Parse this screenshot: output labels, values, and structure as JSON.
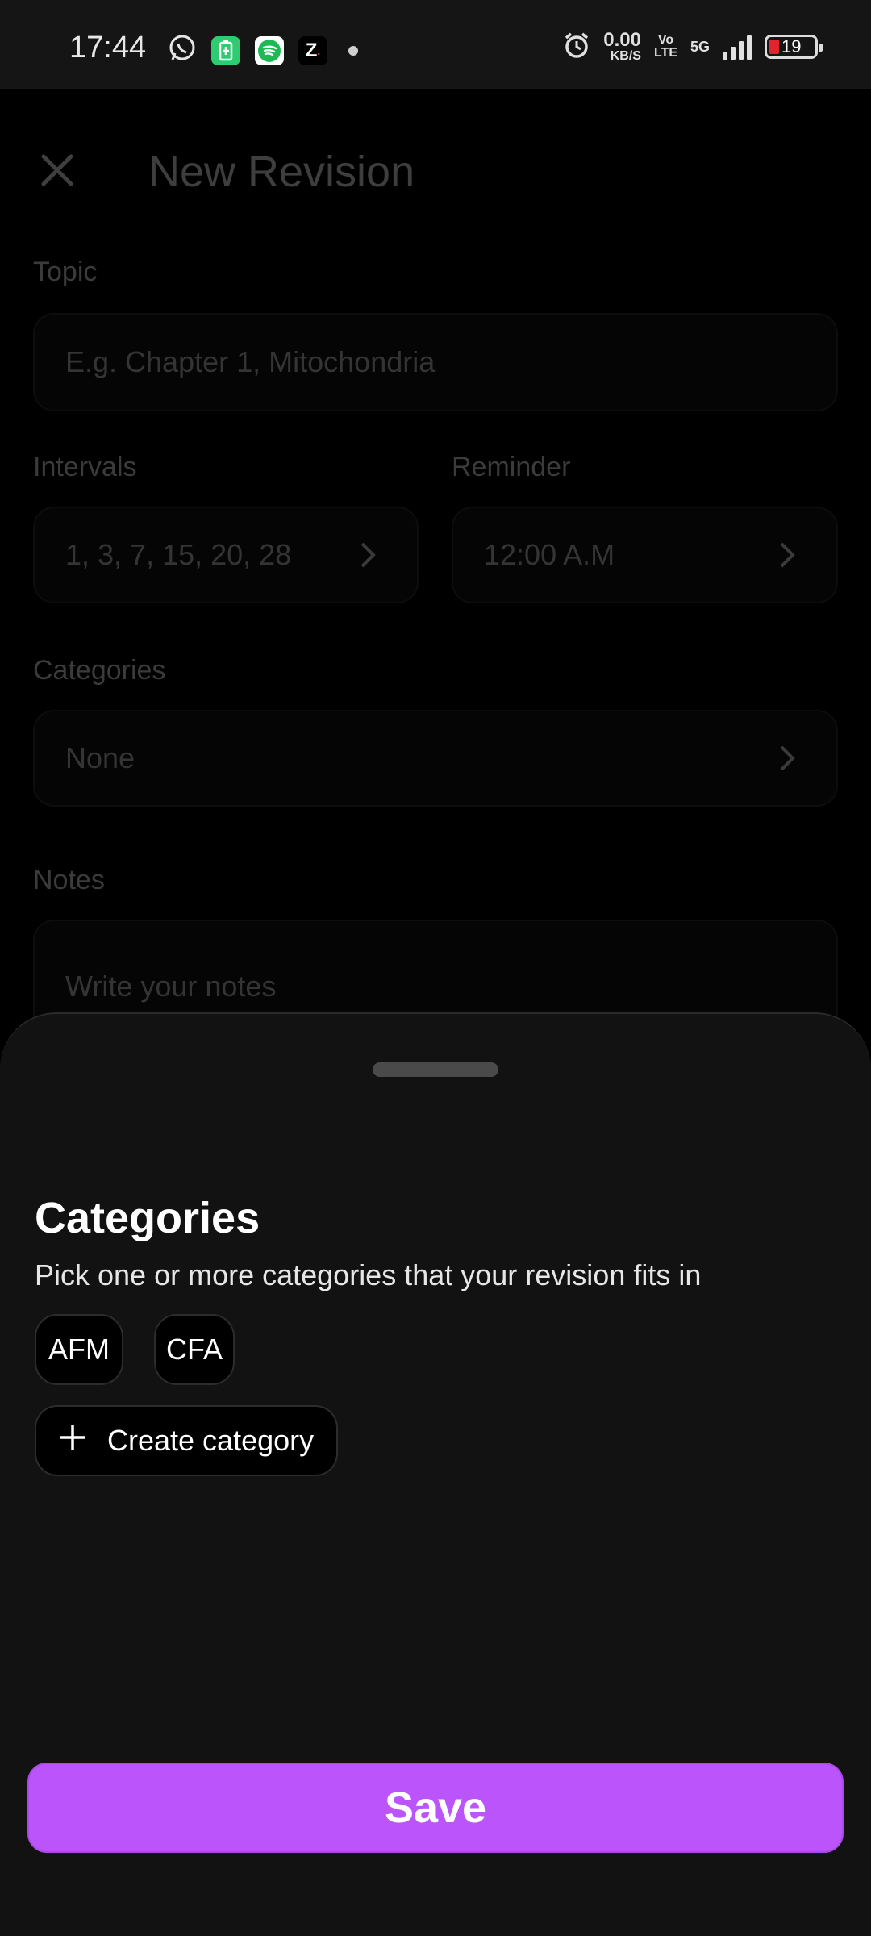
{
  "status_bar": {
    "time": "17:44",
    "net_speed_value": "0.00",
    "net_speed_unit": "KB/S",
    "volte_top": "Vo",
    "volte_bottom": "LTE",
    "network": "5G",
    "battery_level": "19",
    "icons": [
      "whatsapp-icon",
      "battery-saver-icon",
      "spotify-icon",
      "zomato-icon",
      "notification-dot-icon",
      "alarm-icon",
      "signal-icon",
      "battery-icon"
    ]
  },
  "form": {
    "title": "New Revision",
    "topic_label": "Topic",
    "topic_placeholder": "E.g. Chapter 1, Mitochondria",
    "intervals_label": "Intervals",
    "intervals_value": "1, 3, 7, 15, 20, 28",
    "reminder_label": "Reminder",
    "reminder_value": "12:00 A.M",
    "categories_label": "Categories",
    "categories_value": "None",
    "notes_label": "Notes",
    "notes_placeholder": "Write your notes"
  },
  "sheet": {
    "title": "Categories",
    "subtitle": "Pick one or more categories that your revision fits in",
    "chips": [
      "AFM",
      "CFA"
    ],
    "create_label": "Create category",
    "save_label": "Save"
  },
  "colors": {
    "accent": "#bb55fb",
    "sheet_bg": "#121212",
    "background": "#000000"
  }
}
